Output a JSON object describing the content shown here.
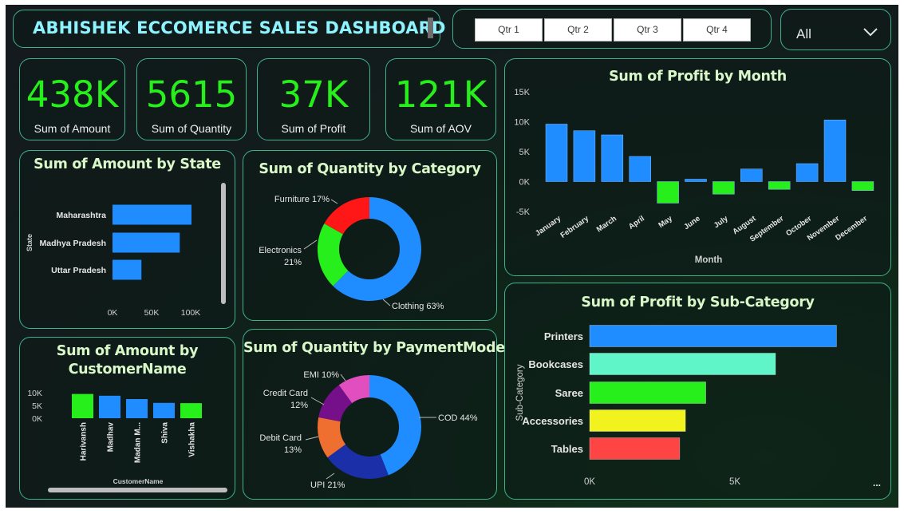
{
  "header": {
    "title": "ABHISHEK ECCOMERCE SALES DASHBOARD"
  },
  "quarter_slicer": [
    "Qtr 1",
    "Qtr 2",
    "Qtr 3",
    "Qtr 4"
  ],
  "dropdown": {
    "value": "All"
  },
  "kpis": [
    {
      "value": "438K",
      "label": "Sum of Amount"
    },
    {
      "value": "5615",
      "label": "Sum of Quantity"
    },
    {
      "value": "37K",
      "label": "Sum of Profit"
    },
    {
      "value": "121K",
      "label": "Sum of AOV"
    }
  ],
  "colors": {
    "accent_green": "#27ef1c",
    "bar_blue": "#1f8cff",
    "title_cyan": "#8ef3ff",
    "card_border": "#3fb28c"
  },
  "chart_data": [
    {
      "id": "state",
      "type": "bar",
      "orientation": "horizontal",
      "title": "Sum of Amount by State",
      "ylabel": "State",
      "categories": [
        "Maharashtra",
        "Madhya Pradesh",
        "Uttar Pradesh"
      ],
      "values": [
        101000,
        86000,
        37000
      ],
      "xticks": [
        "0K",
        "50K",
        "100K"
      ],
      "xlim": [
        0,
        100000
      ]
    },
    {
      "id": "customer",
      "type": "bar",
      "title": "Sum of Amount by CustomerName",
      "xlabel": "CustomerName",
      "categories": [
        "Harivansh",
        "Madhav",
        "Madan M...",
        "Shiva",
        "Vishakha"
      ],
      "values": [
        9500,
        8800,
        7500,
        6000,
        5900
      ],
      "colors": [
        "#27ef1c",
        "#1f8cff",
        "#1f8cff",
        "#1f8cff",
        "#27ef1c"
      ],
      "yticks": [
        "10K",
        "5K",
        "0K"
      ],
      "ylim": [
        0,
        10000
      ]
    },
    {
      "id": "category",
      "type": "pie",
      "donut": true,
      "title": "Sum of Quantity by Category",
      "slices": [
        {
          "name": "Clothing",
          "pct": 63,
          "color": "#1f8cff",
          "label": "Clothing 63%"
        },
        {
          "name": "Electronics",
          "pct": 21,
          "color": "#27ef1c",
          "label": "Electronics\n21%"
        },
        {
          "name": "Furniture",
          "pct": 17,
          "color": "#ff1717",
          "label": "Furniture 17%"
        }
      ]
    },
    {
      "id": "payment",
      "type": "pie",
      "donut": true,
      "title": "Sum of Quantity by PaymentMode",
      "slices": [
        {
          "name": "COD",
          "pct": 44,
          "color": "#1f8cff",
          "label": "COD 44%"
        },
        {
          "name": "UPI",
          "pct": 21,
          "color": "#1a2fa8",
          "label": "UPI 21%"
        },
        {
          "name": "Debit Card",
          "pct": 13,
          "color": "#ee6f2f",
          "label": "Debit Card\n13%"
        },
        {
          "name": "Credit Card",
          "pct": 12,
          "color": "#760f8a",
          "label": "Credit Card\n12%"
        },
        {
          "name": "EMI",
          "pct": 10,
          "color": "#e04fbd",
          "label": "EMI 10%"
        }
      ]
    },
    {
      "id": "month",
      "type": "bar",
      "title": "Sum of Profit by Month",
      "xlabel": "Month",
      "categories": [
        "January",
        "February",
        "March",
        "April",
        "May",
        "June",
        "July",
        "August",
        "September",
        "October",
        "November",
        "December"
      ],
      "values": [
        9600,
        8500,
        7800,
        4200,
        -3600,
        400,
        -2100,
        2100,
        -1300,
        3000,
        10300,
        -1500
      ],
      "yticks": [
        15000,
        10000,
        5000,
        0,
        -5000
      ],
      "ytick_labels": [
        "15K",
        "10K",
        "5K",
        "0K",
        "-5K"
      ],
      "ylim": [
        -5000,
        15000
      ]
    },
    {
      "id": "subcategory",
      "type": "bar",
      "orientation": "horizontal",
      "title": "Sum of Profit by Sub-Category",
      "ylabel": "Sub-Category",
      "categories": [
        "Printers",
        "Bookcases",
        "Saree",
        "Accessories",
        "Tables"
      ],
      "values": [
        8500,
        6400,
        4000,
        3300,
        3100
      ],
      "colors": [
        "#1f8cff",
        "#5ff5c8",
        "#27ef1c",
        "#f2f21e",
        "#ff4444"
      ],
      "xticks": [
        "0K",
        "5K"
      ],
      "xlim": [
        0,
        5000
      ],
      "more_label": "..."
    }
  ]
}
